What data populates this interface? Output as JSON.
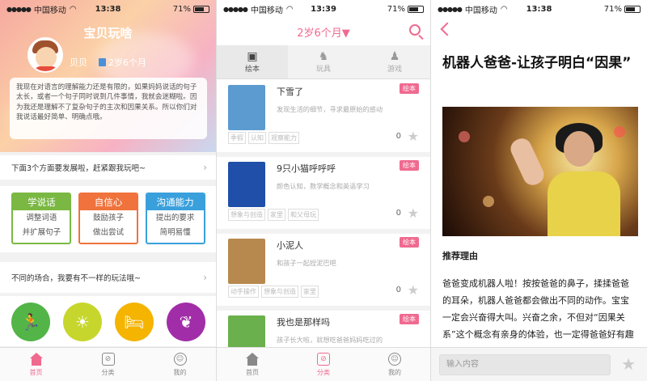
{
  "status_bars": [
    {
      "carrier": "中国移动",
      "time": "13:38",
      "battery": "71%"
    },
    {
      "carrier": "中国移动",
      "time": "13:39",
      "battery": "71%"
    },
    {
      "carrier": "中国移动",
      "time": "13:38",
      "battery": "71%"
    }
  ],
  "panel1": {
    "title": "宝贝玩啥",
    "baby_name": "贝贝",
    "baby_age": "2岁6个月",
    "description": "我现在对语言的理解能力还是有限的，如果妈妈说话的句子太长，或者一个句子同时说到几件事情，我就会迷糊啦。因为我还是理解不了复杂句子的主次和因果关系。所以你们对我说话最好简单、明确点哦。",
    "row1": "下面3个方面要发展啦，赶紧跟我玩吧~",
    "skills": [
      {
        "head": "学说话",
        "line1": "调整词语",
        "line2": "并扩展句子",
        "color": "#7ab843"
      },
      {
        "head": "自信心",
        "line1": "鼓励孩子",
        "line2": "做出尝试",
        "color": "#f0723c"
      },
      {
        "head": "沟通能力",
        "line1": "提出的要求",
        "line2": "简明易懂",
        "color": "#3aa0dc"
      }
    ],
    "row2": "不同的场合，我要有不一样的玩法哦~",
    "circles": [
      {
        "icon": "running-icon",
        "glyph": "🏃",
        "color": "#53b448"
      },
      {
        "icon": "sun-icon",
        "glyph": "☀",
        "color": "#c7d62c"
      },
      {
        "icon": "bed-icon",
        "glyph": "🛏",
        "color": "#f4b400"
      },
      {
        "icon": "leaf-icon",
        "glyph": "❦",
        "color": "#a12ea8"
      }
    ]
  },
  "tabbar": {
    "home": "首页",
    "category": "分类",
    "me": "我的"
  },
  "panel2": {
    "age_selector": "2岁6个月▼",
    "cat_tabs": [
      "绘本",
      "玩具",
      "游戏"
    ],
    "books": [
      {
        "title": "下雪了",
        "sub": "发现生活的细节，寻求最原始的感动",
        "badge": "绘本",
        "tags": [
          "季假",
          "认知",
          "观察能力"
        ],
        "count": "0",
        "cover": "#5b9bd0"
      },
      {
        "title": "9只小猫呼呼呼",
        "sub": "颜色认知，数学概念和英语学习",
        "badge": "绘本",
        "tags": [
          "想象与创造",
          "家里",
          "和父母玩"
        ],
        "count": "0",
        "cover": "#1f4fa8"
      },
      {
        "title": "小泥人",
        "sub": "和孩子一起捏泥巴吧",
        "badge": "绘本",
        "tags": [
          "动手操作",
          "想象与创造",
          "家里"
        ],
        "count": "0",
        "cover": "#b8894e"
      },
      {
        "title": "我也是那样吗",
        "sub": "孩子长大啦，就想吃爸爸妈妈吃过的",
        "badge": "绘本",
        "tags": [],
        "count": "",
        "cover": "#6ab04c"
      }
    ]
  },
  "panel3": {
    "title": "机器人爸爸-让孩子明白“因果”",
    "reason_heading": "推荐理由",
    "body": "爸爸变成机器人啦！按按爸爸的鼻子，揉揉爸爸的耳朵，机器人爸爸都会做出不同的动作。宝宝一定会兴奋得大叫。兴奋之余，不但对“因果关系”这个概念有亲身的体验，也一定得爸爸好有趣啊！",
    "input_placeholder": "输入内容"
  }
}
